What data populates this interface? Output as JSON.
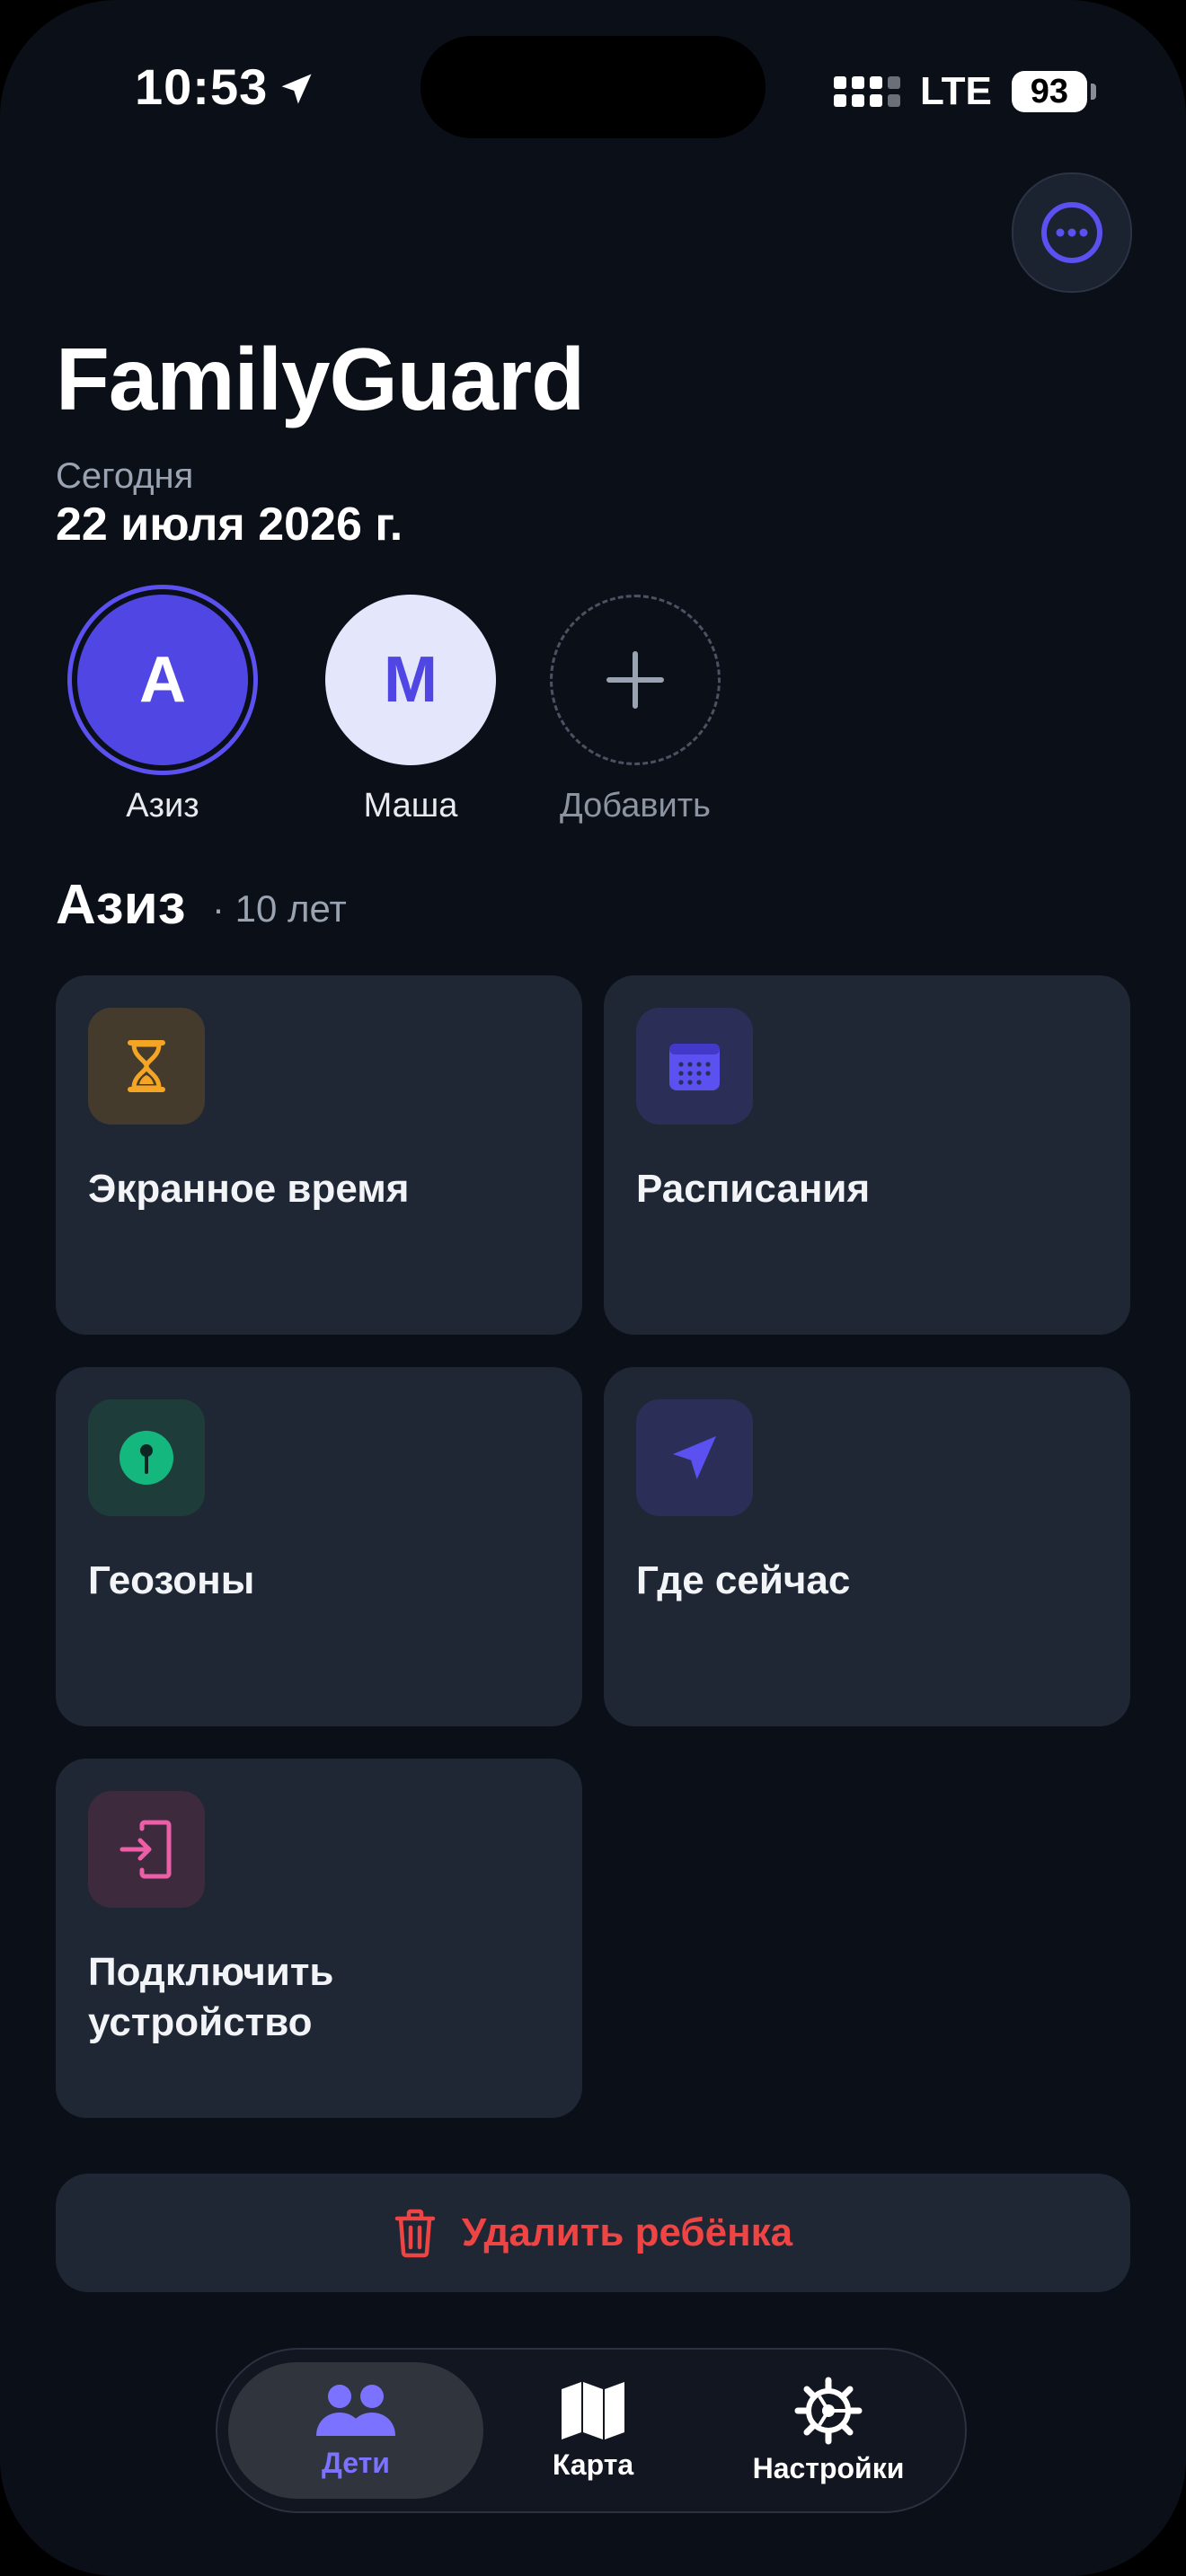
{
  "status_bar": {
    "time": "10:53",
    "network": "LTE",
    "battery": "93"
  },
  "header": {
    "title": "FamilyGuard",
    "date_label": "Сегодня",
    "date_value": "22 июля 2026 г."
  },
  "children": [
    {
      "initial": "А",
      "name": "Азиз",
      "selected": true
    },
    {
      "initial": "М",
      "name": "Маша",
      "selected": false
    }
  ],
  "add_child": {
    "label": "Добавить"
  },
  "selected_child": {
    "name": "Азиз",
    "age": "· 10 лет"
  },
  "cards": [
    {
      "title": "Экранное время",
      "icon": "hourglass-icon",
      "icon_bg": "#443b2c",
      "icon_color": "#f5a524"
    },
    {
      "title": "Расписания",
      "icon": "calendar-icon",
      "icon_bg": "#2b2f57",
      "icon_color": "#5b50f0"
    },
    {
      "title": "Геозоны",
      "icon": "map-pin-icon",
      "icon_bg": "#1e3d3a",
      "icon_color": "#14b87f"
    },
    {
      "title": "Где сейчас",
      "icon": "navigation-arrow-icon",
      "icon_bg": "#2b2f57",
      "icon_color": "#5b50f0"
    },
    {
      "title": "Подключить устройство",
      "icon": "connect-device-icon",
      "icon_bg": "#3d2a3d",
      "icon_color": "#ec5fa6"
    }
  ],
  "delete_button": {
    "label": "Удалить ребёнка",
    "color": "#ef4444"
  },
  "tabs": [
    {
      "label": "Дети",
      "icon": "people-icon",
      "active": true
    },
    {
      "label": "Карта",
      "icon": "map-icon",
      "active": false
    },
    {
      "label": "Настройки",
      "icon": "settings-gear-icon",
      "active": false
    }
  ],
  "colors": {
    "accent": "#5b50f0",
    "background": "#0b0f18",
    "card": "#1f2735"
  }
}
